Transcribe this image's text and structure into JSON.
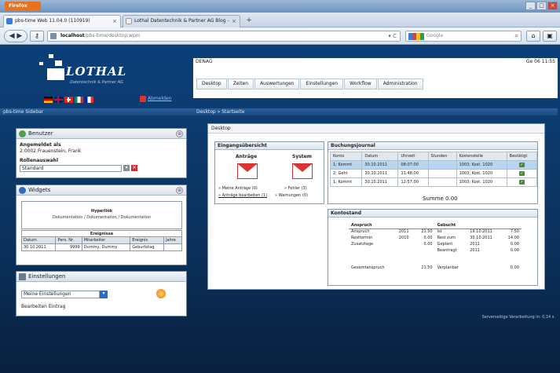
{
  "browser": {
    "menu_button": "Firefox",
    "tabs": [
      {
        "title": "pbs-time Web 11.04.0 (110919)",
        "close": "×"
      },
      {
        "title": "Lothal Datentechnik & Partner AG Blog -",
        "close": "×"
      }
    ],
    "new_tab": "+",
    "url_host": "localhost",
    "url_path": "/pbs-time/desktop.wpm",
    "url_controls": "▾ C",
    "search_placeholder": "Google",
    "win_controls": [
      "_",
      "□",
      "×"
    ]
  },
  "app": {
    "logo_text": "LOTHAL",
    "logo_sub": "Datentechnik & Partner AG",
    "logout": "Abmelden",
    "header_left": "DENAG",
    "header_right": "Ge 06 11:55",
    "menu": [
      "Desktop",
      "Zeiten",
      "Auswertungen",
      "Einstellungen",
      "Workflow",
      "Administration"
    ],
    "side_header": "pbs-time Sidebar",
    "main_header": "Desktop » Startseite",
    "footer_note": "Serverseitige Verarbeitung in: 0,14 s."
  },
  "user_panel": {
    "title": "Benutzer",
    "logged_label": "Angemeldet als",
    "logged_value": "2:0002 Frauenstein, Frank",
    "role_label": "Rollenauswahl",
    "role_value": "Standard",
    "toggle": "⊕"
  },
  "widgets_panel": {
    "title": "Widgets",
    "hyperlink_title": "Hyperlink",
    "hyperlink_text": "Dokumentation / Dokumentation / Dokumentation",
    "events_title": "Ereignisse",
    "events_headers": [
      "Datum",
      "Pers. Nr.",
      "Mitarbeiter",
      "Ereignis",
      "Jahre"
    ],
    "events_rows": [
      [
        "30.10.2011",
        "9999",
        "Dummy, Dummy",
        "Geburtstag",
        ""
      ]
    ],
    "toggle": "⊕"
  },
  "settings_panel": {
    "title": "Einstellungen",
    "select_value": "Meine Einstellungen",
    "edit_link": "Bearbeiten Eintrag",
    "toggle": "⊕"
  },
  "desktop": {
    "title": "Desktop",
    "requests": {
      "title": "Eingangsübersicht",
      "col1": "Anträge",
      "col2": "System",
      "link1": "» Meine Anträge (0)",
      "link2": "» Anträge bearbeiten (1)",
      "link3": "» Fehler (3)",
      "link4": "» Warnungen (0)"
    },
    "journal": {
      "title": "Buchungsjournal",
      "headers": [
        "Konto",
        "Datum",
        "Uhrzeit",
        "Stunden",
        "Kostenstelle",
        "Bestätigt"
      ],
      "rows": [
        [
          "1; Kommt",
          "30.10.2011",
          "08:07:00",
          "",
          "1003; Kost. 1020",
          "✓"
        ],
        [
          "2; Geht",
          "30.10.2011",
          "11:48:00",
          "",
          "1003; Kost. 1020",
          "✓"
        ],
        [
          "1; Kommt",
          "30.10.2011",
          "12:57:00",
          "",
          "1003; Kost. 1020",
          "✓"
        ]
      ],
      "sum": "Summe 0.00"
    },
    "accounts": {
      "title": "Kontostand",
      "left_header": "Anspruch",
      "right_header": "Gebucht",
      "rows": [
        [
          "Anspruch",
          "2011",
          "21.50",
          "Ist",
          "19.10.2011",
          "7.50"
        ],
        [
          "Resttermin",
          "2010",
          "0.00",
          "Rest zum",
          "30.10.2011",
          "14.00"
        ],
        [
          "Zusatztage",
          "",
          "0.00",
          "Geplant",
          "2011",
          "0.00"
        ],
        [
          "",
          "",
          "",
          "Beantragt",
          "2011",
          "0.00"
        ],
        [
          "",
          "",
          "",
          "",
          "",
          ""
        ],
        [
          "Gesamtanspruch",
          "",
          "21.50",
          "Verplanbar",
          "",
          "0.00"
        ]
      ]
    }
  },
  "colors": {
    "app_bg": "#0b3f7a",
    "accent_orange": "#e8731c",
    "selected_row": "#b9d6f0"
  }
}
